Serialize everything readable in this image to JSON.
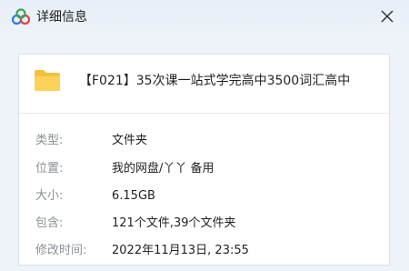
{
  "window": {
    "title": "详细信息",
    "icons": {
      "app": "cloud-logo-icon",
      "close": "close-icon",
      "folder": "folder-icon"
    },
    "colors": {
      "accent": "#2a7be4",
      "folder": "#f5c13b"
    }
  },
  "item": {
    "name": "【F021】35次课一站式学完高中3500词汇高中"
  },
  "details": {
    "type_label": "类型:",
    "type_value": "文件夹",
    "location_label": "位置:",
    "location_value": "我的网盘/丫丫 备用",
    "size_label": "大小:",
    "size_value": "6.15GB",
    "contains_label": "包含:",
    "contains_value": "121个文件,39个文件夹",
    "modified_label": "修改时间:",
    "modified_value": "2022年11月13日, 23:55"
  }
}
